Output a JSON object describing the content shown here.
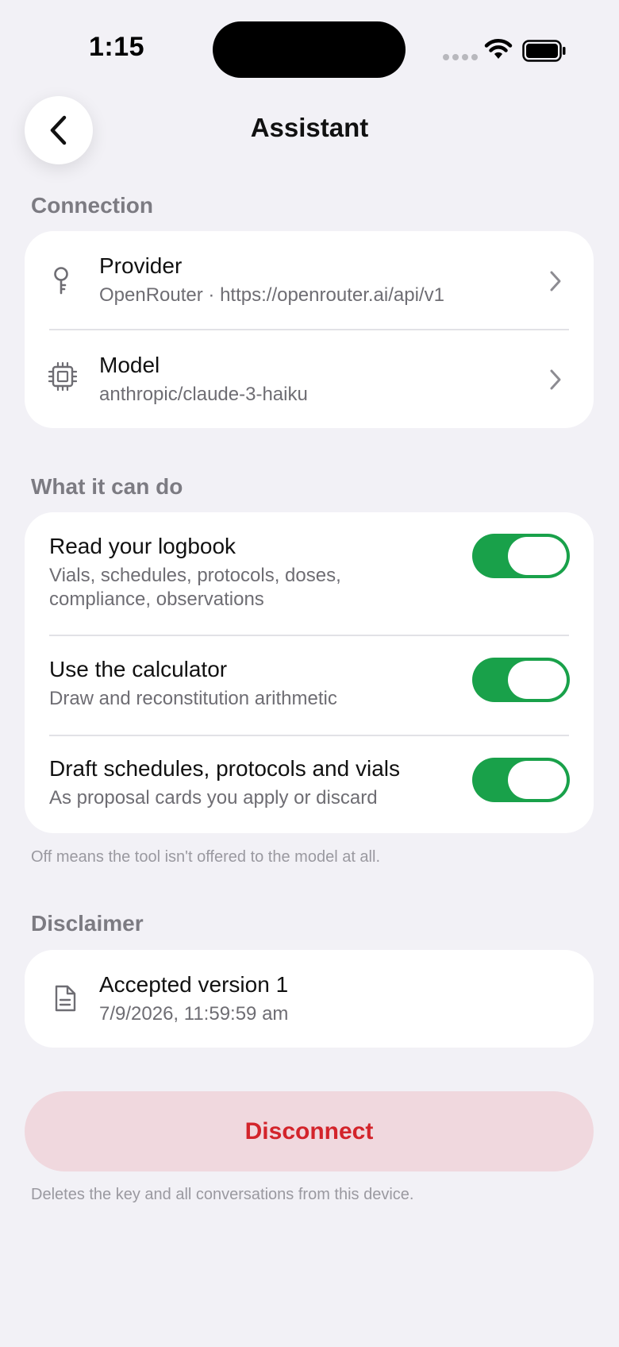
{
  "status_bar": {
    "time": "1:15"
  },
  "header": {
    "title": "Assistant"
  },
  "connection": {
    "section_label": "Connection",
    "provider": {
      "title": "Provider",
      "subtitle": "OpenRouter · https://openrouter.ai/api/v1",
      "icon": "key-icon"
    },
    "model": {
      "title": "Model",
      "subtitle": "anthropic/claude-3-haiku",
      "icon": "chip-icon"
    }
  },
  "capabilities": {
    "section_label": "What it can do",
    "items": [
      {
        "title": "Read your logbook",
        "subtitle_line1": "Vials, schedules, protocols, doses,",
        "subtitle_line2": "compliance, observations",
        "enabled": true
      },
      {
        "title": "Use the calculator",
        "subtitle_line1": "Draw and reconstitution arithmetic",
        "enabled": true
      },
      {
        "title": "Draft schedules, protocols and vials",
        "subtitle_line1": "As proposal cards you apply or discard",
        "enabled": true
      }
    ],
    "footnote": "Off means the tool isn't offered to the model at all."
  },
  "disclaimer": {
    "section_label": "Disclaimer",
    "title": "Accepted version 1",
    "subtitle": "7/9/2026, 11:59:59 am",
    "icon": "document-icon"
  },
  "disconnect": {
    "label": "Disconnect",
    "footnote": "Deletes the key and all conversations from this device."
  },
  "colors": {
    "background": "#f2f1f6",
    "toggle_on": "#19a14a",
    "danger_text": "#d3242b",
    "danger_bg": "#f0d8de"
  }
}
